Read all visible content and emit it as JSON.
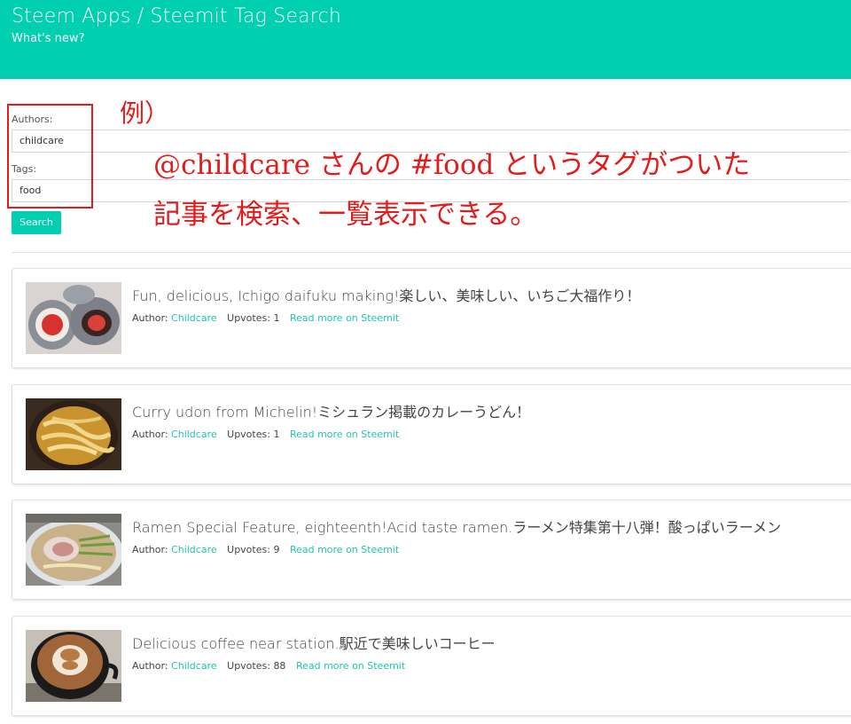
{
  "header": {
    "title": "Steem Apps / Steemit Tag Search",
    "subtitle": "What's new?"
  },
  "form": {
    "authors_label": "Authors:",
    "authors_value": "childcare",
    "tags_label": "Tags:",
    "tags_value": "food",
    "search_label": "Search"
  },
  "annotation": {
    "example": "例）",
    "line1": "@childcare さんの #food というタグがついた",
    "line2": "記事を検索、一覧表示できる。"
  },
  "results": [
    {
      "title": "Fun, delicious, Ichigo daifuku making!楽しい、美味しい、いちご大福作り！",
      "author_label": "Author:",
      "author": "Childcare",
      "upvotes_label": "Upvotes:",
      "upvotes": "1",
      "link": "Read more on Steemit",
      "thumb": "strawberry-daifuku-photo"
    },
    {
      "title": "Curry udon from Michelin!ミシュラン掲載のカレーうどん！",
      "author_label": "Author:",
      "author": "Childcare",
      "upvotes_label": "Upvotes:",
      "upvotes": "1",
      "link": "Read more on Steemit",
      "thumb": "curry-udon-photo"
    },
    {
      "title": "Ramen Special Feature, eighteenth!Acid taste ramen.ラーメン特集第十八弾！酸っぱいラーメン",
      "author_label": "Author:",
      "author": "Childcare",
      "upvotes_label": "Upvotes:",
      "upvotes": "9",
      "link": "Read more on Steemit",
      "thumb": "ramen-photo"
    },
    {
      "title": "Delicious coffee near station.駅近で美味しいコーヒー",
      "author_label": "Author:",
      "author": "Childcare",
      "upvotes_label": "Upvotes:",
      "upvotes": "88",
      "link": "Read more on Steemit",
      "thumb": "latte-art-photo"
    }
  ],
  "colors": {
    "accent": "#00cfb0",
    "link": "#1fc7ad",
    "annotation": "#e31b1b"
  }
}
